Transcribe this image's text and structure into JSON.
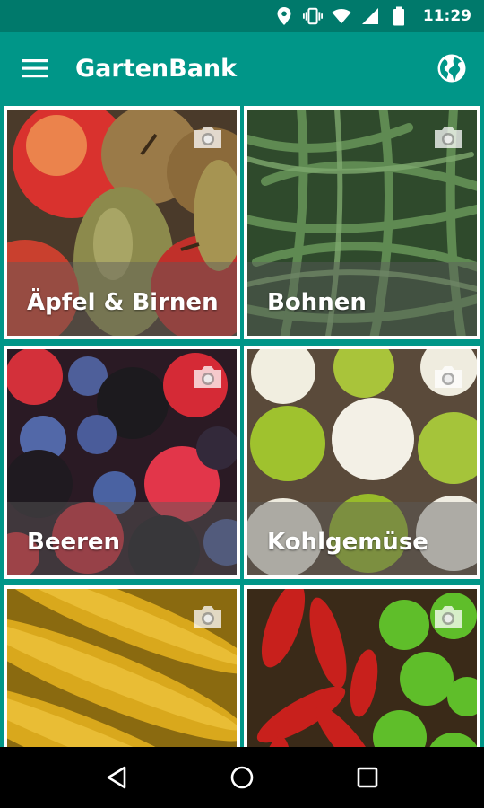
{
  "status_bar": {
    "time": "11:29",
    "icons": [
      "location-icon",
      "vibrate-icon",
      "wifi-icon",
      "signal-icon",
      "battery-icon"
    ]
  },
  "app_bar": {
    "title": "GartenBank",
    "menu_icon": "menu-icon",
    "action_icon": "globe-icon",
    "color": "#009688"
  },
  "tiles": [
    {
      "label": "Äpfel & Birnen",
      "icon": "camera-icon"
    },
    {
      "label": "Bohnen",
      "icon": "camera-icon"
    },
    {
      "label": "Beeren",
      "icon": "camera-icon"
    },
    {
      "label": "Kohlgemüse",
      "icon": "camera-icon"
    },
    {
      "label": "",
      "icon": "camera-icon"
    },
    {
      "label": "",
      "icon": "camera-icon"
    }
  ],
  "nav_bar": {
    "icons": [
      "back-icon",
      "home-icon",
      "recents-icon"
    ]
  }
}
